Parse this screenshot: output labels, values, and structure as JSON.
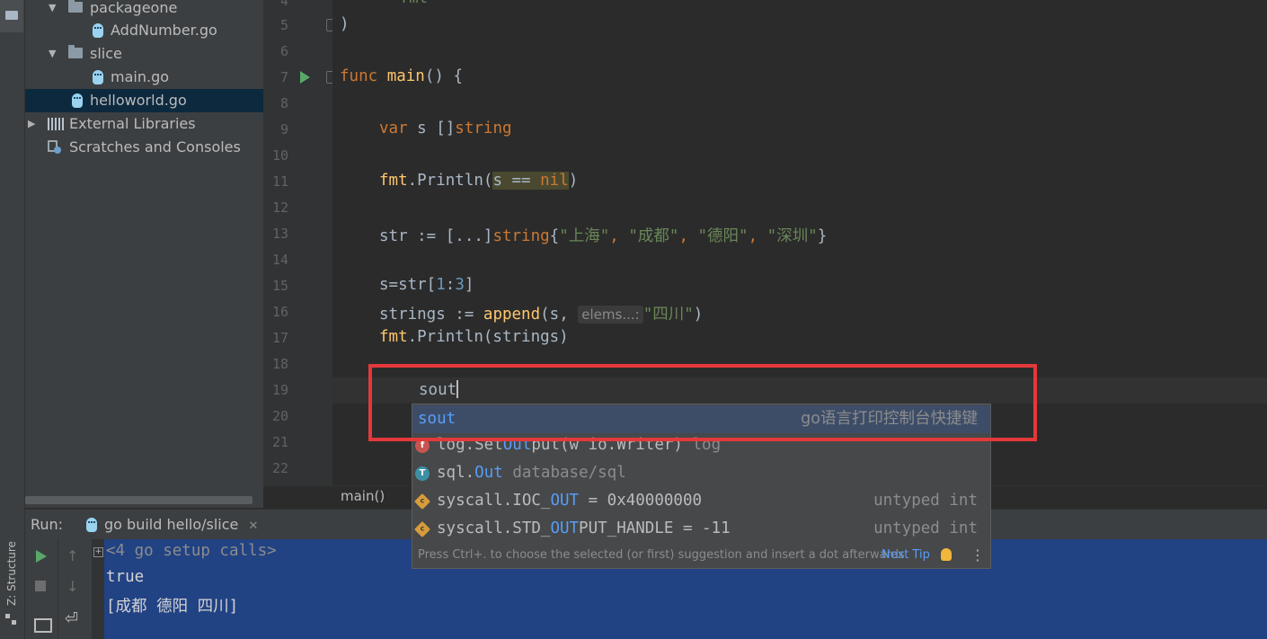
{
  "left_strip": {
    "structure_tab_label": "Z: Structure"
  },
  "project_tree": {
    "items": [
      {
        "label": "packageone",
        "kind": "folder",
        "expanded": true
      },
      {
        "label": "AddNumber.go",
        "kind": "go-file"
      },
      {
        "label": "slice",
        "kind": "folder",
        "expanded": true
      },
      {
        "label": "main.go",
        "kind": "go-file"
      },
      {
        "label": "helloworld.go",
        "kind": "go-file",
        "selected": true
      },
      {
        "label": "External Libraries",
        "kind": "libraries",
        "expanded": false
      },
      {
        "label": "Scratches and Consoles",
        "kind": "scratches"
      }
    ]
  },
  "editor": {
    "line_numbers": [
      "4",
      "5",
      "6",
      "7",
      "8",
      "9",
      "10",
      "11",
      "12",
      "13",
      "14",
      "15",
      "16",
      "17",
      "18",
      "19",
      "20",
      "21",
      "22"
    ],
    "partial_top": "\"fmt\"",
    "lines": {
      "l5": ")",
      "l7_kw": "func",
      "l7_fn": "main",
      "l7_rest": "() {",
      "l9_kw": "var",
      "l9_mid": " s []",
      "l9_type": "string",
      "l11_pkg": "fmt",
      "l11_fn": ".Println(",
      "l11_s": "s",
      "l11_op": " == ",
      "l11_nil": "nil",
      "l11_end": ")",
      "l13_a": "str := [...]",
      "l13_type": "string",
      "l13_b": "{",
      "l13_s1": "\"上海\"",
      "l13_c1": ", ",
      "l13_s2": "\"成都\"",
      "l13_c2": ", ",
      "l13_s3": "\"德阳\"",
      "l13_c3": ", ",
      "l13_s4": "\"深圳\"",
      "l13_end": "}",
      "l15_a": "s=str[",
      "l15_n1": "1",
      "l15_colon": ":",
      "l15_n2": "3",
      "l15_end": "]",
      "l16_a": "strings := ",
      "l16_fn": "append",
      "l16_b": "(s, ",
      "l16_hint": "elems...:",
      "l16_str": "\"四川\"",
      "l16_end": ")",
      "l17_pkg": "fmt",
      "l17_rest": ".Println(strings)",
      "l19_typed": "sout"
    }
  },
  "breadcrumb": {
    "text": "main()"
  },
  "completion": {
    "items": [
      {
        "name": "sout",
        "desc": "go语言打印控制台快捷键",
        "selected": true
      },
      {
        "name_pre": "log.Set",
        "name_match": "Out",
        "name_post": "put(w io.Writer)",
        "type": "log",
        "icon": "f"
      },
      {
        "name_pre": "sql.",
        "name_match": "Out",
        "name_post": "",
        "type": "database/sql",
        "icon": "T"
      },
      {
        "name_pre": "syscall.IOC_",
        "name_match": "OUT",
        "name_post": " = 0x40000000",
        "type": "untyped int",
        "icon": "c"
      },
      {
        "name_pre": "syscall.STD_",
        "name_match": "OUT",
        "name_post": "PUT_HANDLE = -11",
        "type": "untyped int",
        "icon": "c"
      }
    ],
    "footer_tip": "Press Ctrl+. to choose the selected (or first) suggestion and insert a dot afterwards",
    "next_tip": "Next Tip"
  },
  "run": {
    "label": "Run:",
    "tab": "go build hello/slice",
    "console_lines": [
      "<4 go setup calls>",
      "true",
      "[成都 德阳 四川]"
    ]
  },
  "colors": {
    "annotation_box": "#e5383b",
    "selection": "#214283",
    "keyword": "#cc7832",
    "string": "#6a8759"
  }
}
